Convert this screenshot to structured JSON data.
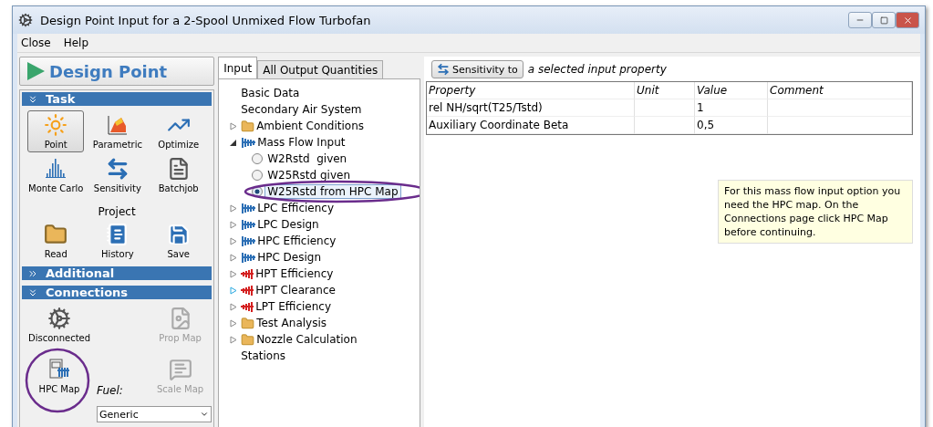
{
  "window": {
    "title": "Design Point Input for a 2-Spool Unmixed Flow Turbofan"
  },
  "menu": [
    "Close",
    "Help"
  ],
  "sidebar": {
    "header": "Design Point",
    "task": {
      "label": "Task",
      "expanded": true,
      "tools": [
        {
          "label": "Point",
          "selected": true
        },
        {
          "label": "Parametric",
          "selected": false
        },
        {
          "label": "Optimize",
          "selected": false
        },
        {
          "label": "Monte Carlo",
          "selected": false
        },
        {
          "label": "Sensitivity",
          "selected": false
        },
        {
          "label": "Batchjob",
          "selected": false
        }
      ],
      "group_label": "Project",
      "project_tools": [
        {
          "label": "Read"
        },
        {
          "label": "History"
        },
        {
          "label": "Save"
        }
      ]
    },
    "additional": {
      "label": "Additional",
      "expanded": false
    },
    "connections": {
      "label": "Connections",
      "expanded": true,
      "items": [
        {
          "label": "Disconnected",
          "disabled": false
        },
        {
          "label": "Prop Map",
          "disabled": true
        },
        {
          "label": "HPC Map",
          "disabled": false
        },
        {
          "label": "Scale Map",
          "disabled": true
        }
      ],
      "fuel_label": "Fuel:",
      "fuel_value": "Generic"
    }
  },
  "tabs": [
    {
      "label": "Input",
      "selected": true
    },
    {
      "label": "All Output Quantities",
      "selected": false
    }
  ],
  "tree": [
    {
      "label": "Basic Data",
      "kind": "plain"
    },
    {
      "label": "Secondary Air System",
      "kind": "plain"
    },
    {
      "label": "Ambient Conditions",
      "kind": "folder",
      "expanded": false,
      "hovered": false
    },
    {
      "label": "Mass Flow Input",
      "kind": "compressor",
      "expanded": true,
      "hovered": false,
      "children": [
        {
          "label": "W2Rstd  given",
          "selected": false
        },
        {
          "label": "W25Rstd given",
          "selected": false
        },
        {
          "label": "W25Rstd from HPC Map",
          "selected": true
        }
      ]
    },
    {
      "label": "LPC Efficiency",
      "kind": "compressor",
      "expanded": false,
      "hovered": false
    },
    {
      "label": "LPC Design",
      "kind": "compressor",
      "expanded": false,
      "hovered": false
    },
    {
      "label": "HPC Efficiency",
      "kind": "compressor",
      "expanded": false,
      "hovered": false
    },
    {
      "label": "HPC Design",
      "kind": "compressor",
      "expanded": false,
      "hovered": false
    },
    {
      "label": "HPT Efficiency",
      "kind": "turbine",
      "expanded": false,
      "hovered": false
    },
    {
      "label": "HPT Clearance",
      "kind": "turbine",
      "expanded": false,
      "hovered": true
    },
    {
      "label": "LPT Efficiency",
      "kind": "turbine",
      "expanded": false,
      "hovered": false
    },
    {
      "label": "Test Analysis",
      "kind": "folder",
      "expanded": false,
      "hovered": false
    },
    {
      "label": "Nozzle Calculation",
      "kind": "folder",
      "expanded": false,
      "hovered": false
    },
    {
      "label": "Stations",
      "kind": "plain"
    }
  ],
  "sensitivity": {
    "button": "Sensitivity to",
    "caption": "a selected input property"
  },
  "table": {
    "columns": [
      "Property",
      "Unit",
      "Value",
      "Comment"
    ],
    "rows": [
      [
        "rel NH/sqrt(T25/Tstd)",
        "",
        "1",
        ""
      ],
      [
        "Auxiliary Coordinate Beta",
        "",
        "0,5",
        ""
      ]
    ]
  },
  "note": "For this mass flow input option you need  the  HPC map.  On the Connections page  click HPC Map before continuing."
}
